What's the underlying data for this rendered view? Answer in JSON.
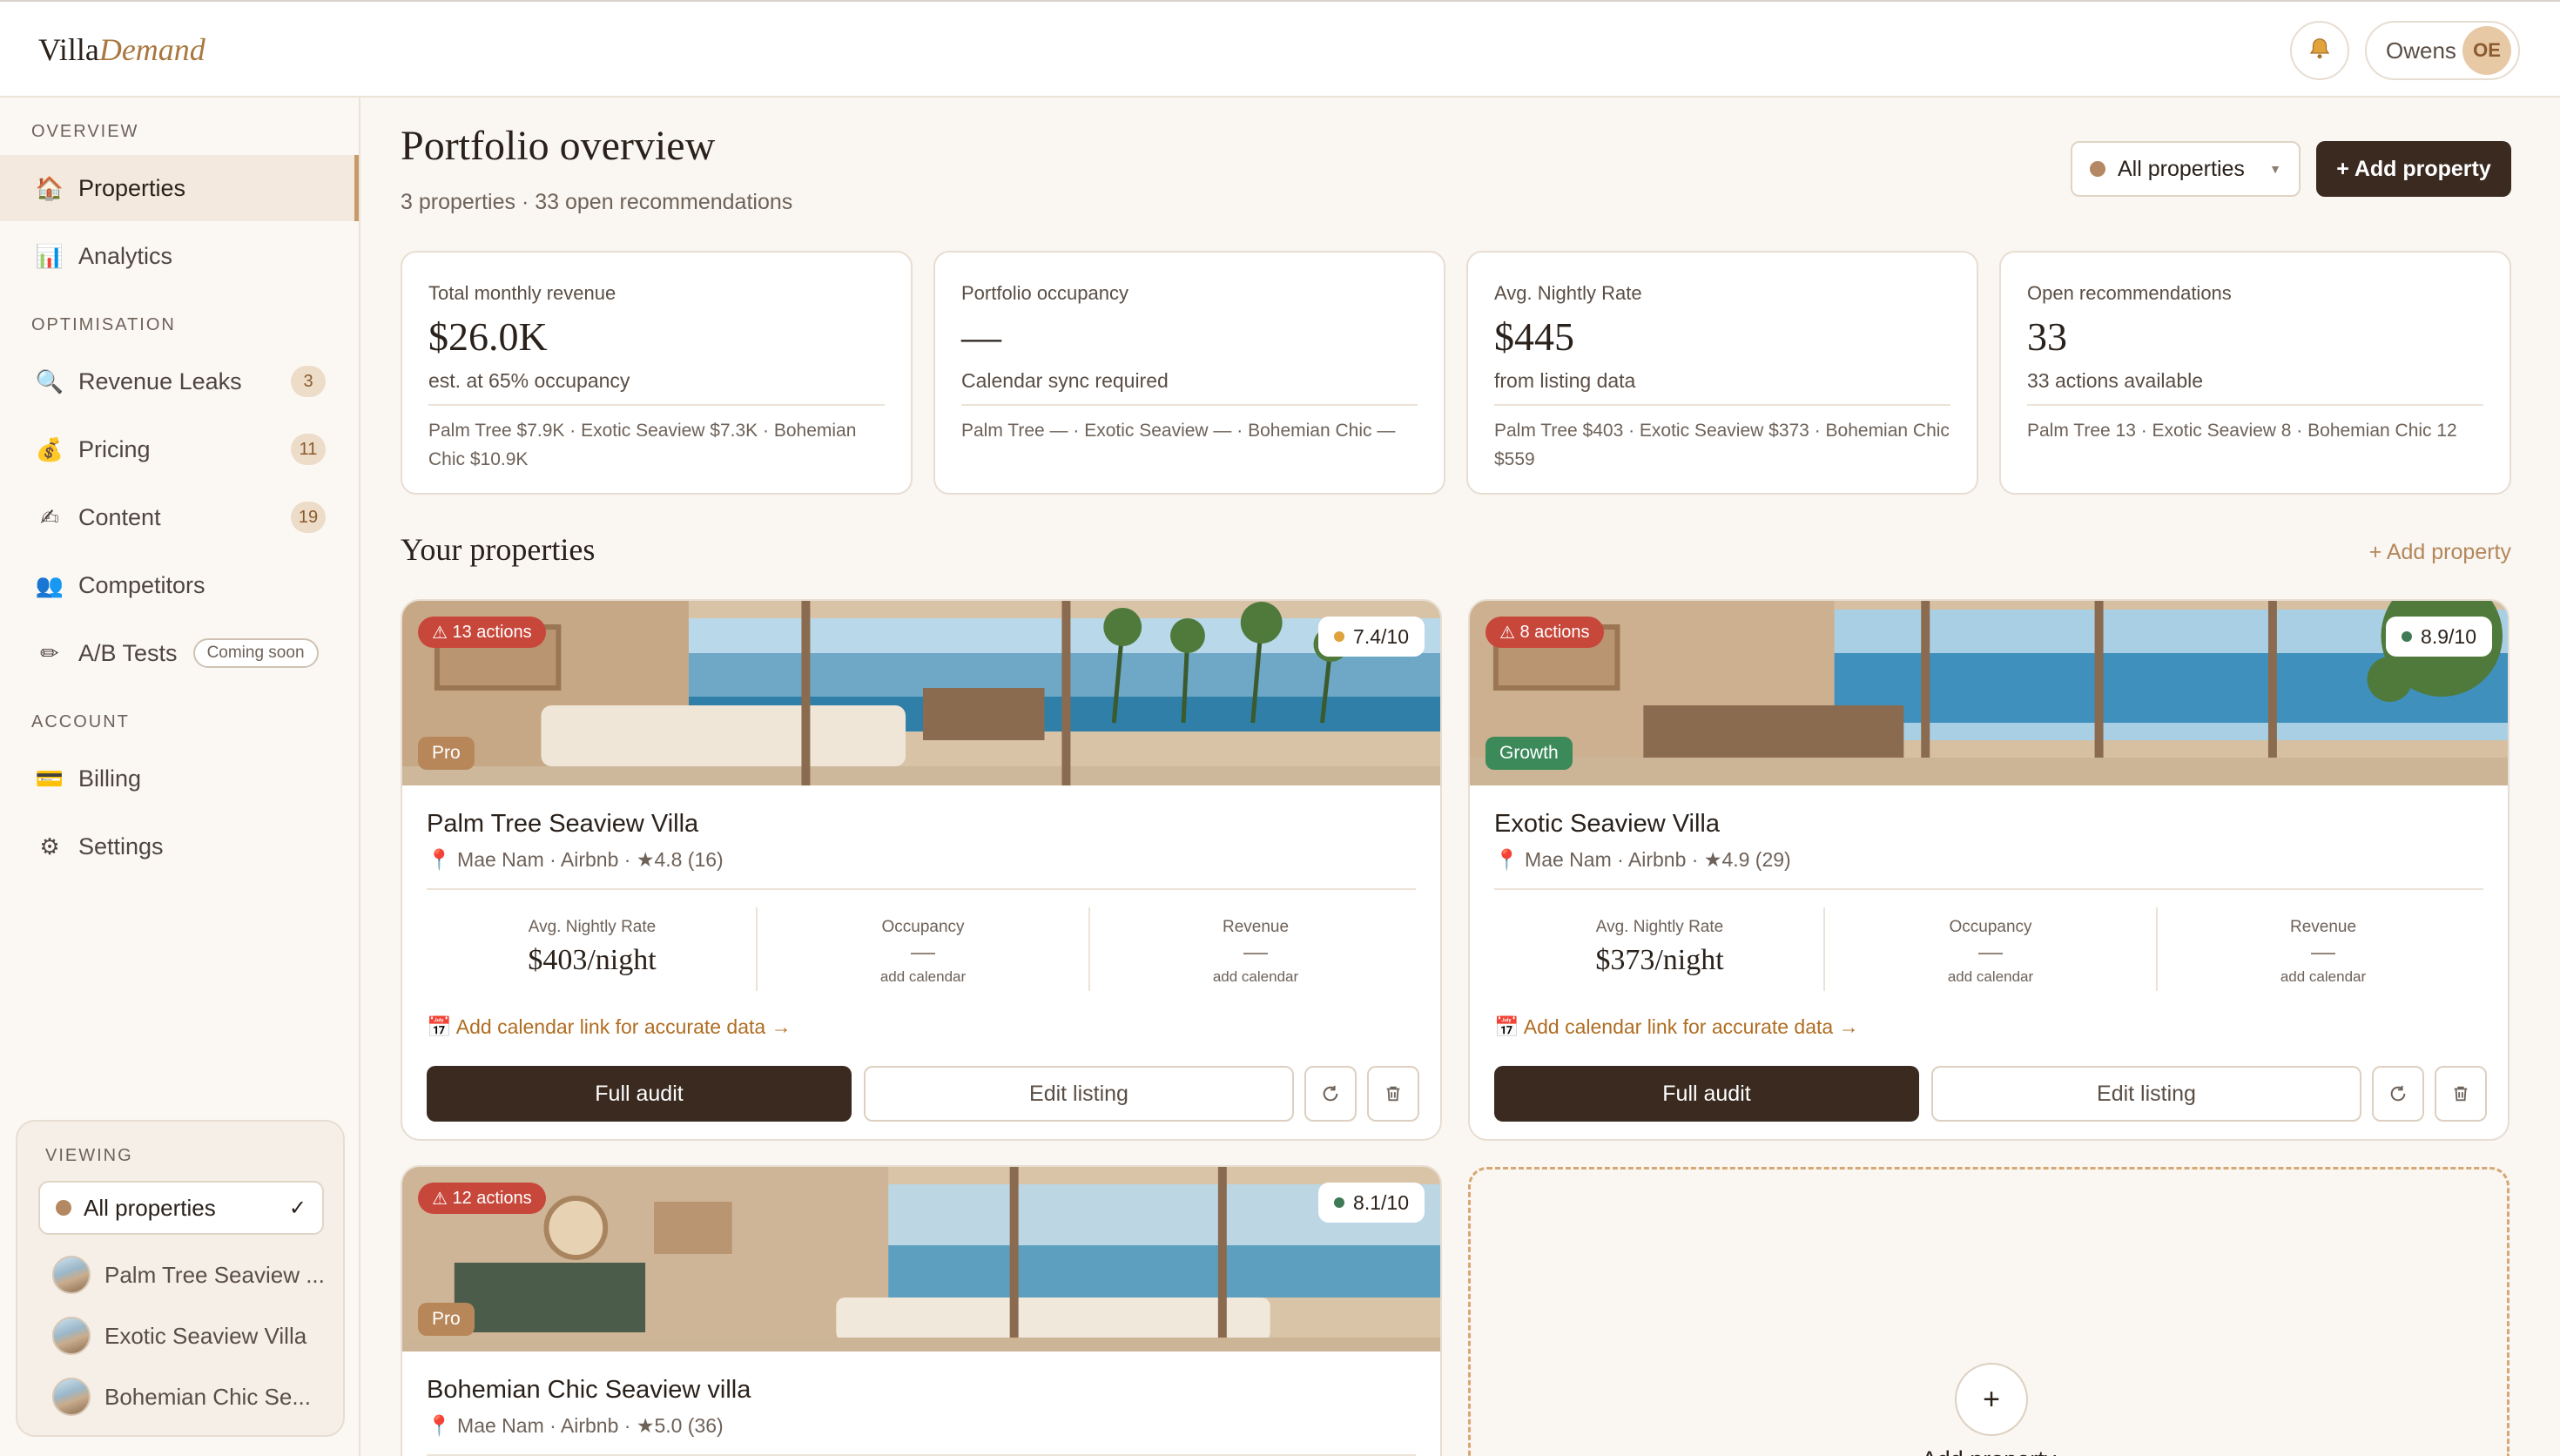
{
  "app": {
    "logo_main": "Villa",
    "logo_accent": "Demand",
    "user_name": "Owens",
    "user_initials": "OE"
  },
  "sidebar": {
    "sections": {
      "overview": "OVERVIEW",
      "optimisation": "OPTIMISATION",
      "account": "ACCOUNT"
    },
    "items": [
      {
        "label": "Properties",
        "icon": "house-icon",
        "active": true
      },
      {
        "label": "Analytics",
        "icon": "bar-chart-icon"
      },
      {
        "label": "Revenue Leaks",
        "icon": "magnifier-icon",
        "count": "3"
      },
      {
        "label": "Pricing",
        "icon": "money-bag-icon",
        "count": "11"
      },
      {
        "label": "Content",
        "icon": "pen-icon",
        "count": "19"
      },
      {
        "label": "Competitors",
        "icon": "people-icon"
      },
      {
        "label": "A/B Tests",
        "icon": "pencil-icon",
        "badge": "Coming soon"
      },
      {
        "label": "Billing",
        "icon": "card-icon"
      },
      {
        "label": "Settings",
        "icon": "gear-icon"
      }
    ],
    "viewing": {
      "label": "VIEWING",
      "selected": "All properties",
      "items": [
        "Palm Tree Seaview ...",
        "Exotic Seaview Villa",
        "Bohemian Chic Se..."
      ]
    }
  },
  "header": {
    "title": "Portfolio overview",
    "subtitle": "3 properties · 33 open recommendations",
    "filter_label": "All properties",
    "add_label": "+ Add property"
  },
  "stats": [
    {
      "title": "Total monthly revenue",
      "value": "$26.0K",
      "sub": "est. at 65% occupancy",
      "breakdown": "Palm Tree $7.9K · Exotic Seaview $7.3K · Bohemian Chic $10.9K"
    },
    {
      "title": "Portfolio occupancy",
      "value": "—",
      "sub": "Calendar sync required",
      "breakdown": "Palm Tree — · Exotic Seaview — · Bohemian Chic —"
    },
    {
      "title": "Avg. Nightly Rate",
      "value": "$445",
      "sub": "from listing data",
      "breakdown": "Palm Tree $403 · Exotic Seaview $373 · Bohemian Chic $559"
    },
    {
      "title": "Open recommendations",
      "value": "33",
      "sub": "33 actions available",
      "breakdown": "Palm Tree 13 · Exotic Seaview 8 · Bohemian Chic 12"
    }
  ],
  "properties_section": {
    "title": "Your properties",
    "add_link": "+ Add property"
  },
  "properties": [
    {
      "actions": "13 actions",
      "score": "7.4/10",
      "score_color": "#e0a23a",
      "tier": "Pro",
      "tier_color": "#b7875a",
      "name": "Palm Tree Seaview Villa",
      "meta": "Mae Nam · Airbnb · ★4.8 (16)",
      "rate_label": "Avg. Nightly Rate",
      "rate": "$403/night",
      "occ_label": "Occupancy",
      "occ": "—",
      "occ_hint": "add calendar",
      "rev_label": "Revenue",
      "rev": "—",
      "rev_hint": "add calendar",
      "cal_link": "Add calendar link for accurate data →",
      "audit": "Full audit",
      "edit": "Edit listing"
    },
    {
      "actions": "8 actions",
      "score": "8.9/10",
      "score_color": "#3f7a55",
      "tier": "Growth",
      "tier_color": "#3c8a5a",
      "name": "Exotic Seaview Villa",
      "meta": "Mae Nam · Airbnb · ★4.9 (29)",
      "rate_label": "Avg. Nightly Rate",
      "rate": "$373/night",
      "occ_label": "Occupancy",
      "occ": "—",
      "occ_hint": "add calendar",
      "rev_label": "Revenue",
      "rev": "—",
      "rev_hint": "add calendar",
      "cal_link": "Add calendar link for accurate data →",
      "audit": "Full audit",
      "edit": "Edit listing"
    },
    {
      "actions": "12 actions",
      "score": "8.1/10",
      "score_color": "#3f7a55",
      "tier": "Pro",
      "tier_color": "#b7875a",
      "name": "Bohemian Chic Seaview villa",
      "meta": "Mae Nam · Airbnb · ★5.0 (36)"
    }
  ],
  "add_card": {
    "plus": "+",
    "label": "Add property"
  }
}
